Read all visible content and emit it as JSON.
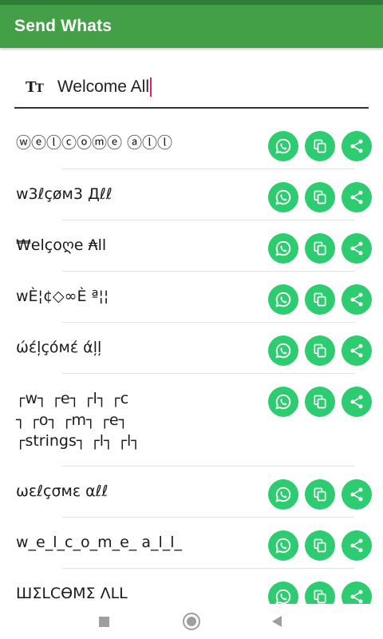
{
  "appbar": {
    "title": "Send Whats"
  },
  "input": {
    "icon": "text-format-icon",
    "icon_label_big": "T",
    "icon_label_small": "T",
    "value": "Welcome All"
  },
  "rows": [
    {
      "text": "ⓦⓔⓛⓒⓞⓜⓔ ⓐⓛⓛ",
      "h": 64
    },
    {
      "text": "w3ℓçøм3 Дℓℓ",
      "h": 64
    },
    {
      "text": "₩elçoღe ₳ll",
      "h": 64
    },
    {
      "text": "wÈ¦¢◇∞È ª¦¦",
      "h": 64
    },
    {
      "text": "ώέļçόмέ άļļ",
      "h": 64
    },
    {
      "text": "┌w┐ ┌e┐ ┌l┐ ┌c\n┐ ┌o┐ ┌m┐ ┌e┐\n┌strings┐ ┌l┐ ┌l┐",
      "h": 116
    },
    {
      "text": "ωεℓçσмε αℓℓ",
      "h": 64
    },
    {
      "text": "w_e_l_c_o_m_e_ a_l_l_",
      "h": 64
    },
    {
      "text": "ШΣLCӨMΣ ΛLL",
      "h": 64
    }
  ],
  "actions": {
    "whatsapp": "whatsapp-icon",
    "copy": "copy-icon",
    "share": "share-icon"
  },
  "colors": {
    "appbar": "#43a047",
    "button": "#2ecc71",
    "caret": "#e91e63"
  },
  "navbar": {
    "recent": "recent-apps-icon",
    "home": "home-icon",
    "back": "back-icon"
  }
}
